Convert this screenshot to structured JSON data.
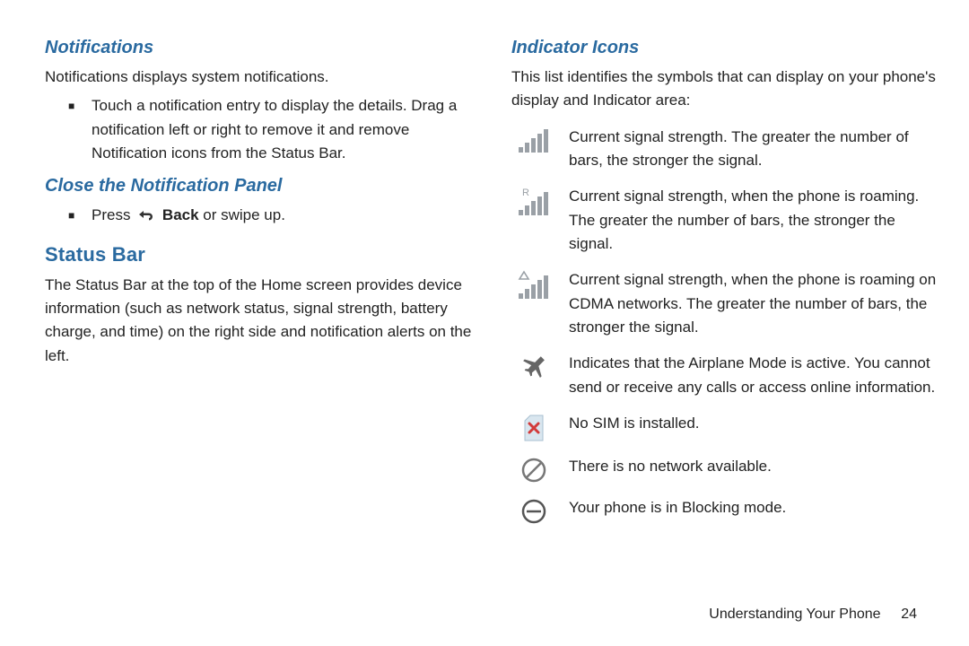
{
  "left": {
    "h_notifications": "Notifications",
    "notifications_intro": "Notifications displays system notifications.",
    "notifications_bullet": "Touch a notification entry to display the details. Drag a notification left or right to remove it and remove Notification icons from the Status Bar.",
    "h_close_panel": "Close the Notification Panel",
    "close_press": "Press ",
    "close_back": "Back",
    "close_rest": " or swipe up.",
    "h_status_bar": "Status Bar",
    "status_bar_body": "The Status Bar at the top of the Home screen provides device information (such as network status, signal strength, battery charge, and time) on the right side and notification alerts on the left."
  },
  "right": {
    "h_indicator": "Indicator Icons",
    "intro": "This list identifies the symbols that can display on your phone's display and Indicator area:",
    "items": [
      "Current signal strength. The greater the number of bars, the stronger the signal.",
      "Current signal strength, when the phone is roaming. The greater the number of bars, the stronger the signal.",
      "Current signal strength, when the phone is roaming on CDMA networks. The greater the number of bars, the stronger the signal.",
      "Indicates that the Airplane Mode is active. You cannot send or receive any calls or access online information.",
      "No SIM is installed.",
      "There is no network available.",
      "Your phone is in Blocking mode."
    ]
  },
  "footer": {
    "section": "Understanding Your Phone",
    "page": "24"
  }
}
